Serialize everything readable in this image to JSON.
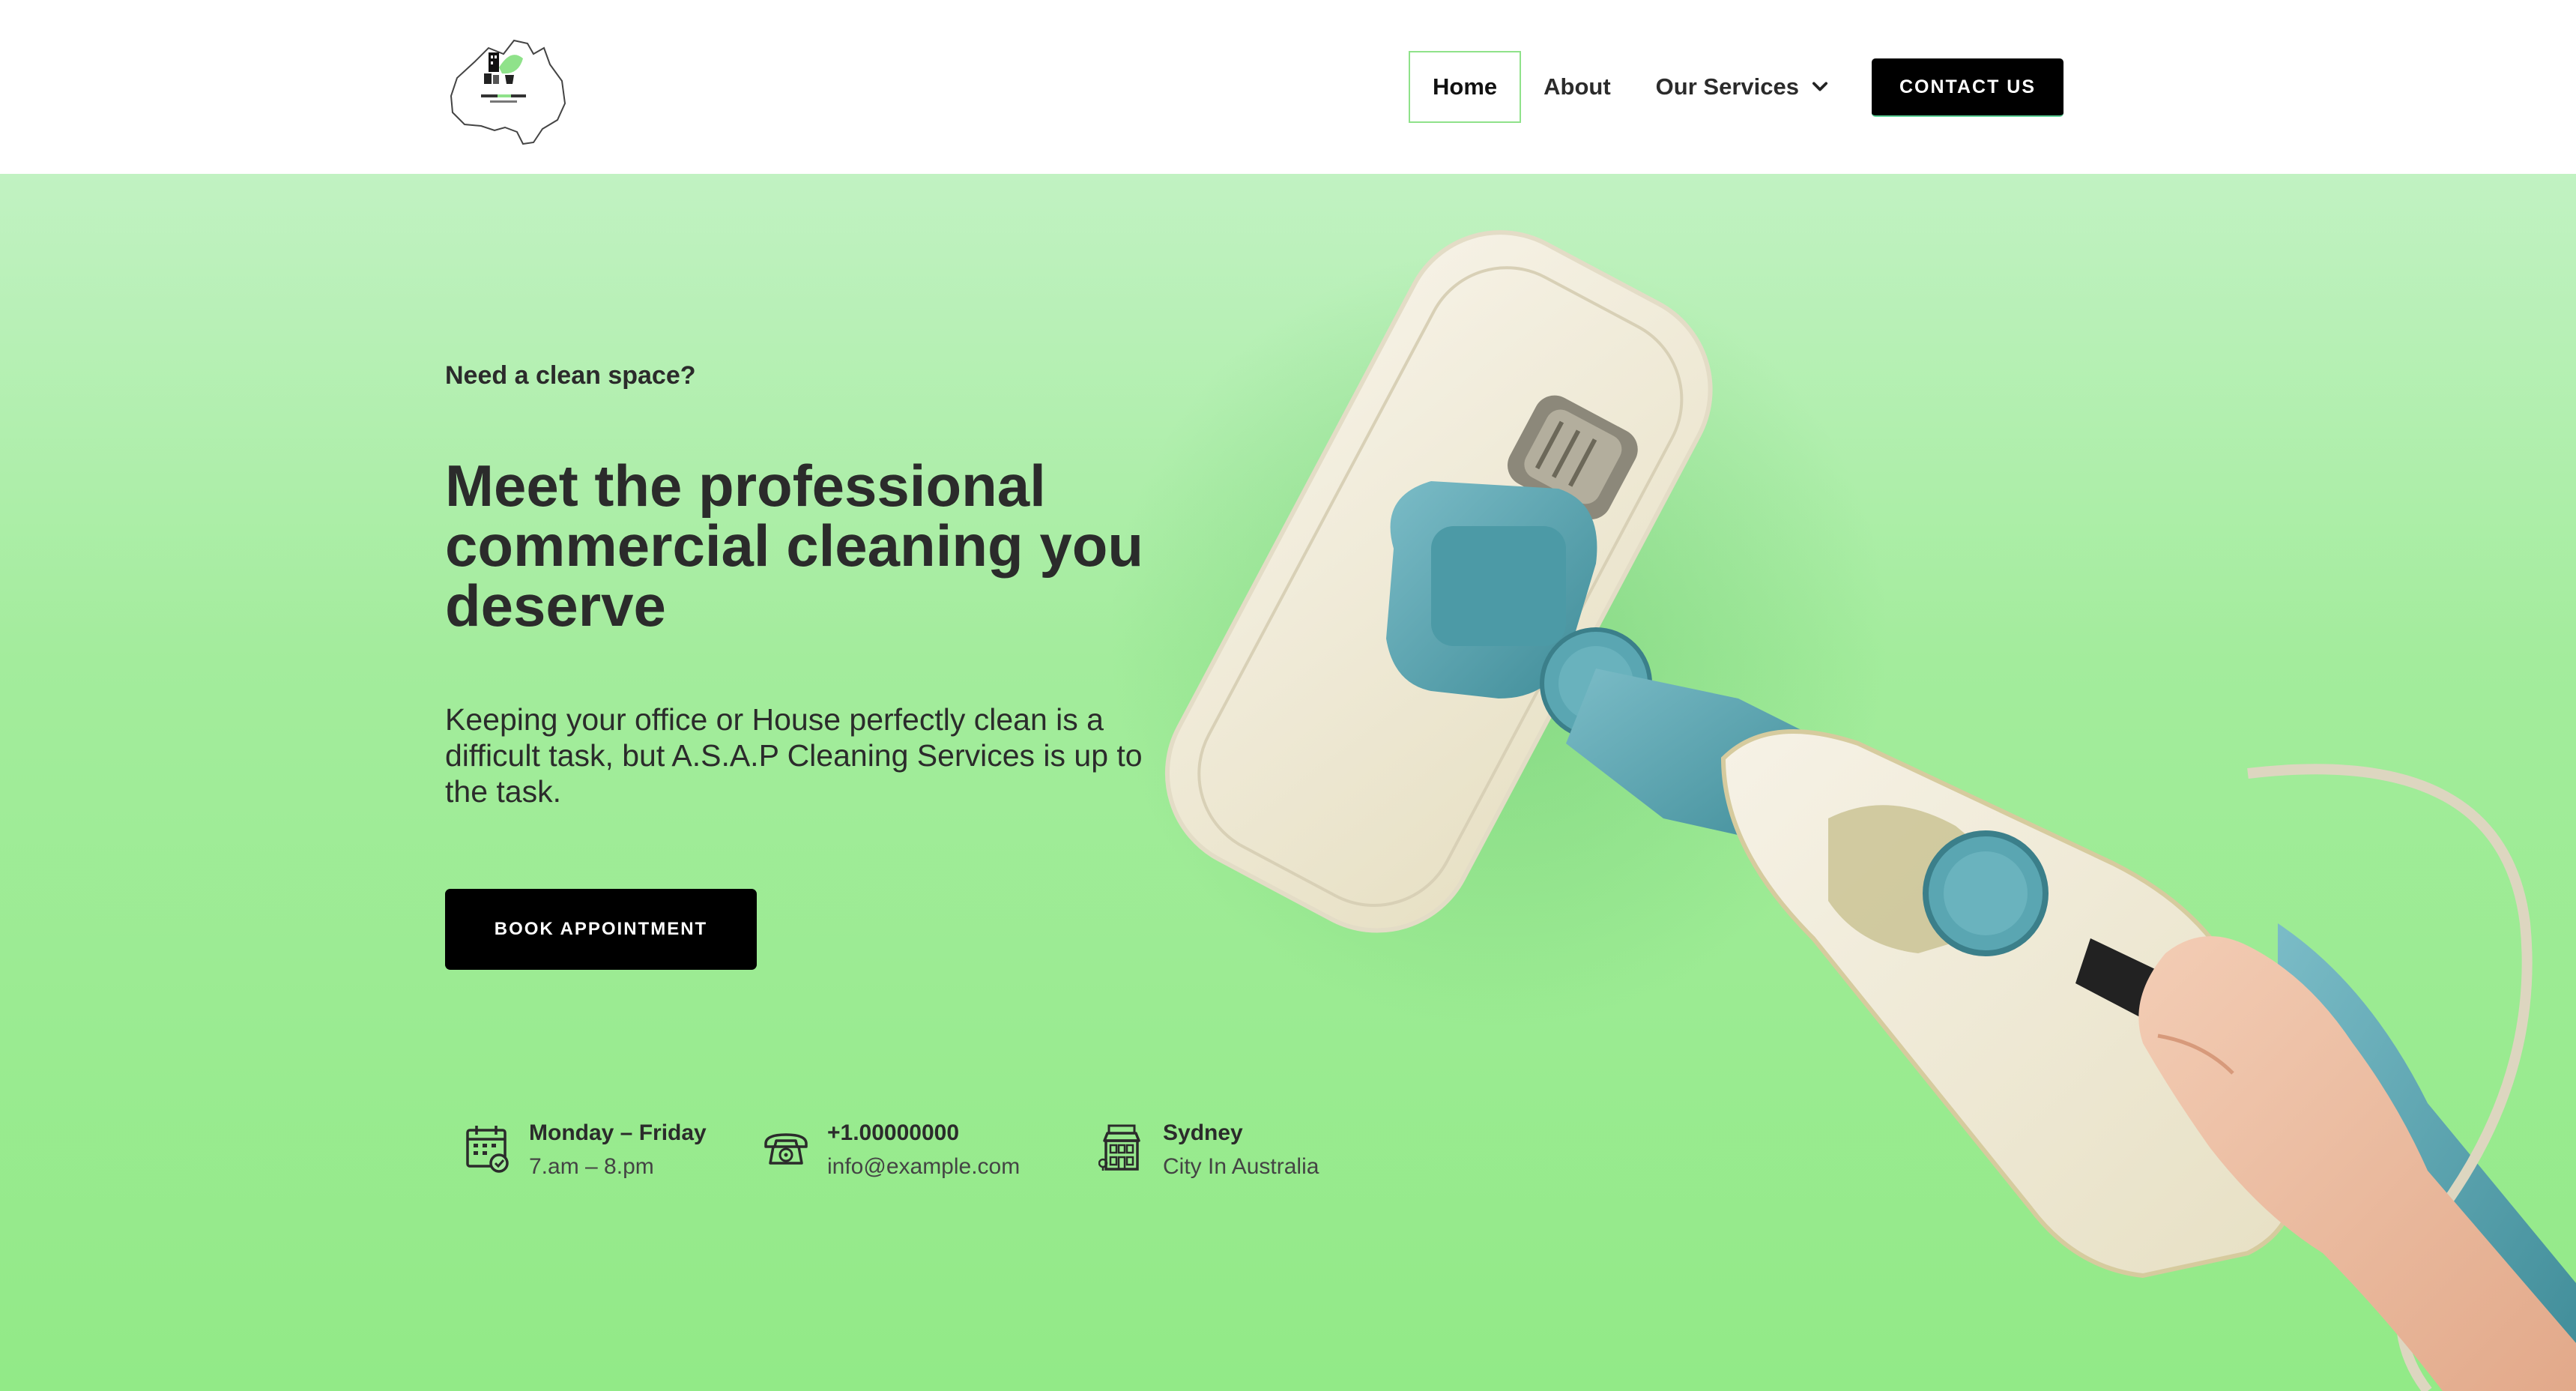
{
  "header": {
    "logo_name": "A.S.A.P Cleaning Services logo",
    "nav": {
      "home": "Home",
      "about": "About",
      "services": "Our Services"
    },
    "contact_label": "CONTACT US"
  },
  "hero": {
    "eyebrow": "Need a clean space?",
    "headline": "Meet the professional commercial cleaning you deserve",
    "lead": "Keeping your office or House perfectly clean is a difficult task, but A.S.A.P Cleaning Services is up to the task.",
    "book_label": "BOOK APPOINTMENT",
    "info": [
      {
        "icon": "calendar-icon",
        "title": "Monday – Friday",
        "sub": "7.am – 8.pm"
      },
      {
        "icon": "telephone-icon",
        "title": "+1.00000000",
        "sub": "info@example.com"
      },
      {
        "icon": "building-icon",
        "title": "Sydney",
        "sub": "City In Australia"
      }
    ]
  },
  "colors": {
    "accent": "#8fe28a",
    "hero_top": "#c1f2c2",
    "hero_bottom": "#92ea87",
    "button": "#000000",
    "mop_teal": "#5fa9b5"
  }
}
